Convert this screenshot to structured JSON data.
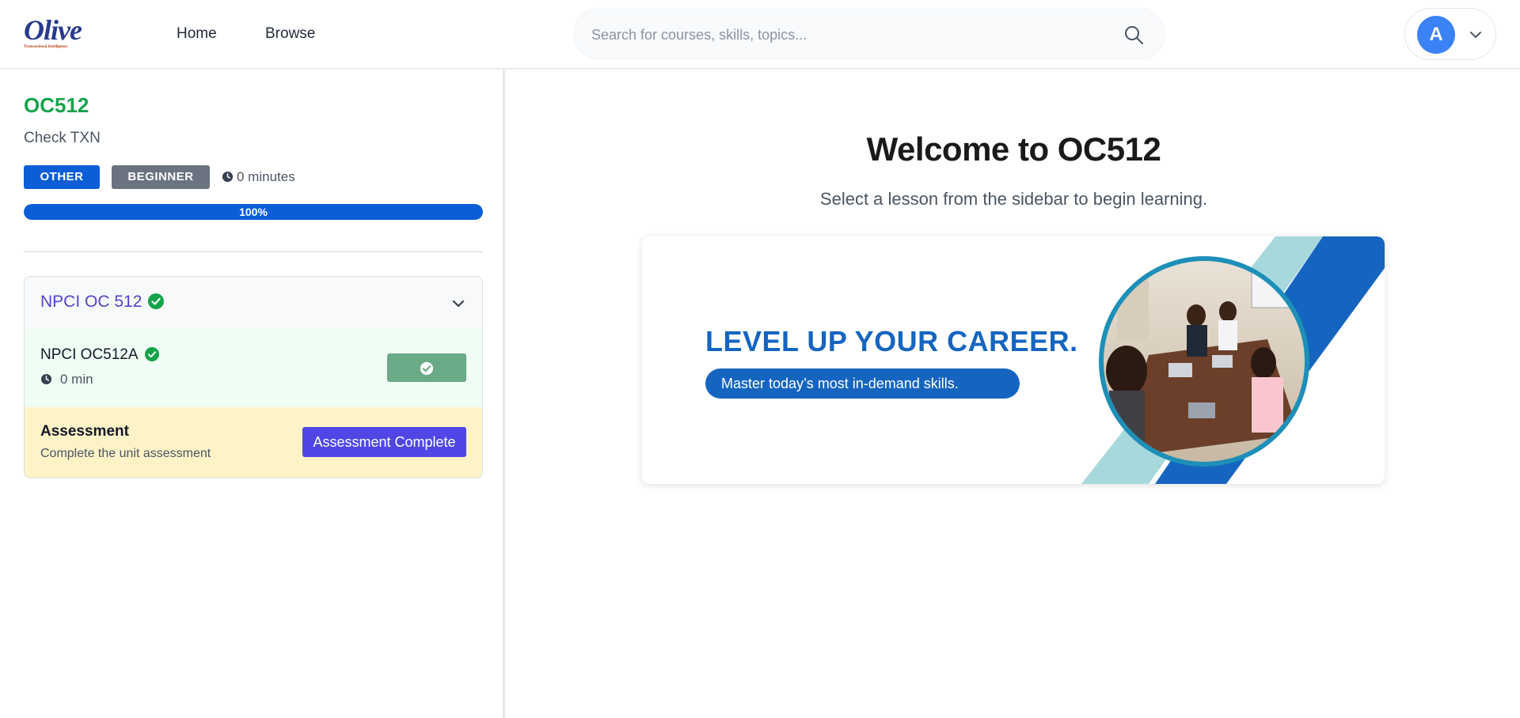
{
  "header": {
    "logo_text": "Olive",
    "logo_subtitle": "Transactional Intelligence",
    "nav": [
      {
        "label": "Home"
      },
      {
        "label": "Browse"
      }
    ],
    "search_placeholder": "Search for courses, skills, topics...",
    "avatar_initial": "A"
  },
  "course": {
    "code": "OC512",
    "subtitle": "Check TXN",
    "category_badge": "OTHER",
    "level_badge": "BEGINNER",
    "duration": "0 minutes",
    "progress_percent": 100,
    "progress_label": "100%"
  },
  "unit": {
    "title": "NPCI OC 512",
    "completed": true,
    "lessons": [
      {
        "title": "NPCI OC512A",
        "duration": "0 min",
        "completed": true
      }
    ],
    "assessment": {
      "title": "Assessment",
      "description": "Complete the unit assessment",
      "button_label": "Assessment Complete"
    }
  },
  "main": {
    "welcome_title": "Welcome to OC512",
    "welcome_subtitle": "Select a lesson from the sidebar to begin learning.",
    "banner": {
      "headline": "LEVEL UP YOUR CAREER.",
      "tagline": "Master today’s most in-demand skills."
    }
  },
  "colors": {
    "accent_green": "#16a34a",
    "primary_blue": "#0b5ed7",
    "indigo": "#4f46e5",
    "unit_title": "#4f46c8",
    "banner_blue": "#1565c0",
    "lesson_bg": "#f0fdf4",
    "assessment_bg": "#fef3c7"
  },
  "icons": {
    "search": "search-icon",
    "user_menu": "chevron-down-icon",
    "duration": "clock-icon",
    "completed": "check-circle-icon",
    "collapse": "chevron-down-icon"
  }
}
